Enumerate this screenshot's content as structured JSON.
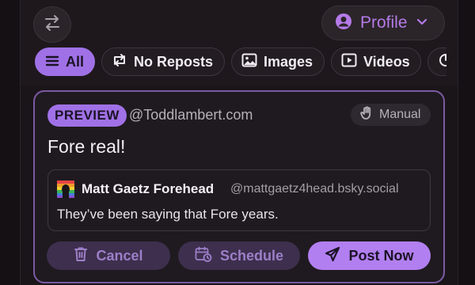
{
  "header": {
    "swap_icon": "swap-arrows-icon",
    "profile_label": "Profile",
    "profile_icon": "user-circle-icon",
    "dropdown_icon": "chevron-down-icon",
    "accent_color": "#b57ae8"
  },
  "filters": [
    {
      "label": "All",
      "icon": "menu-lines-icon",
      "active": true
    },
    {
      "label": "No Reposts",
      "icon": "repost-icon",
      "active": false
    },
    {
      "label": "Images",
      "icon": "image-icon",
      "active": false
    },
    {
      "label": "Videos",
      "icon": "video-icon",
      "active": false
    },
    {
      "label": "",
      "icon": "more-filter-icon",
      "active": false
    }
  ],
  "preview": {
    "badge": "PREVIEW",
    "handle": "@Toddlambert.com",
    "mode_label": "Manual",
    "mode_icon": "hand-icon",
    "text": "Fore real!",
    "quote": {
      "name": "Matt Gaetz Forehead",
      "handle": "@mattgaetz4head.bsky.social",
      "text": "They’ve been saying that Fore years."
    }
  },
  "actions": {
    "cancel": "Cancel",
    "schedule": "Schedule",
    "post": "Post Now"
  }
}
